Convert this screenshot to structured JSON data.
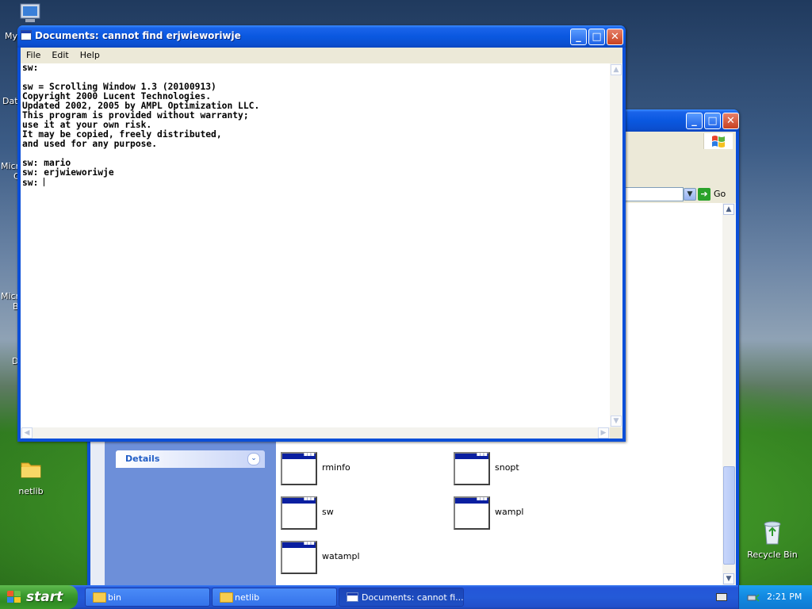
{
  "desktop": {
    "icons": [
      {
        "label": "netlib",
        "icon": "folder-icon"
      },
      {
        "label": "Recycle Bin",
        "icon": "recycle-bin-icon"
      }
    ],
    "cut_labels": [
      "My",
      "Dat",
      "Micr",
      "C",
      "Micr",
      "B",
      "D"
    ]
  },
  "explorer": {
    "go_label": "Go",
    "details_label": "Details",
    "files": [
      "rminfo",
      "snopt",
      "sw",
      "wampl",
      "watampl"
    ]
  },
  "sw_window": {
    "title": "Documents: cannot find erjwieworiwje",
    "menu": [
      "File",
      "Edit",
      "Help"
    ],
    "console_lines": [
      "sw:",
      "",
      "sw = Scrolling Window 1.3 (20100913)",
      "Copyright 2000 Lucent Technologies.",
      "Updated 2002, 2005 by AMPL Optimization LLC.",
      "This program is provided without warranty;",
      "use it at your own risk.",
      "It may be copied, freely distributed,",
      "and used for any purpose.",
      "",
      "sw: mario",
      "sw: erjwieworiwje",
      "sw: "
    ]
  },
  "taskbar": {
    "start_label": "start",
    "buttons": [
      {
        "label": "bin",
        "icon": "folder-icon"
      },
      {
        "label": "netlib",
        "icon": "folder-icon"
      },
      {
        "label": "Documents: cannot fi...",
        "icon": "window-icon",
        "active": true
      }
    ],
    "clock": "2:21 PM"
  }
}
